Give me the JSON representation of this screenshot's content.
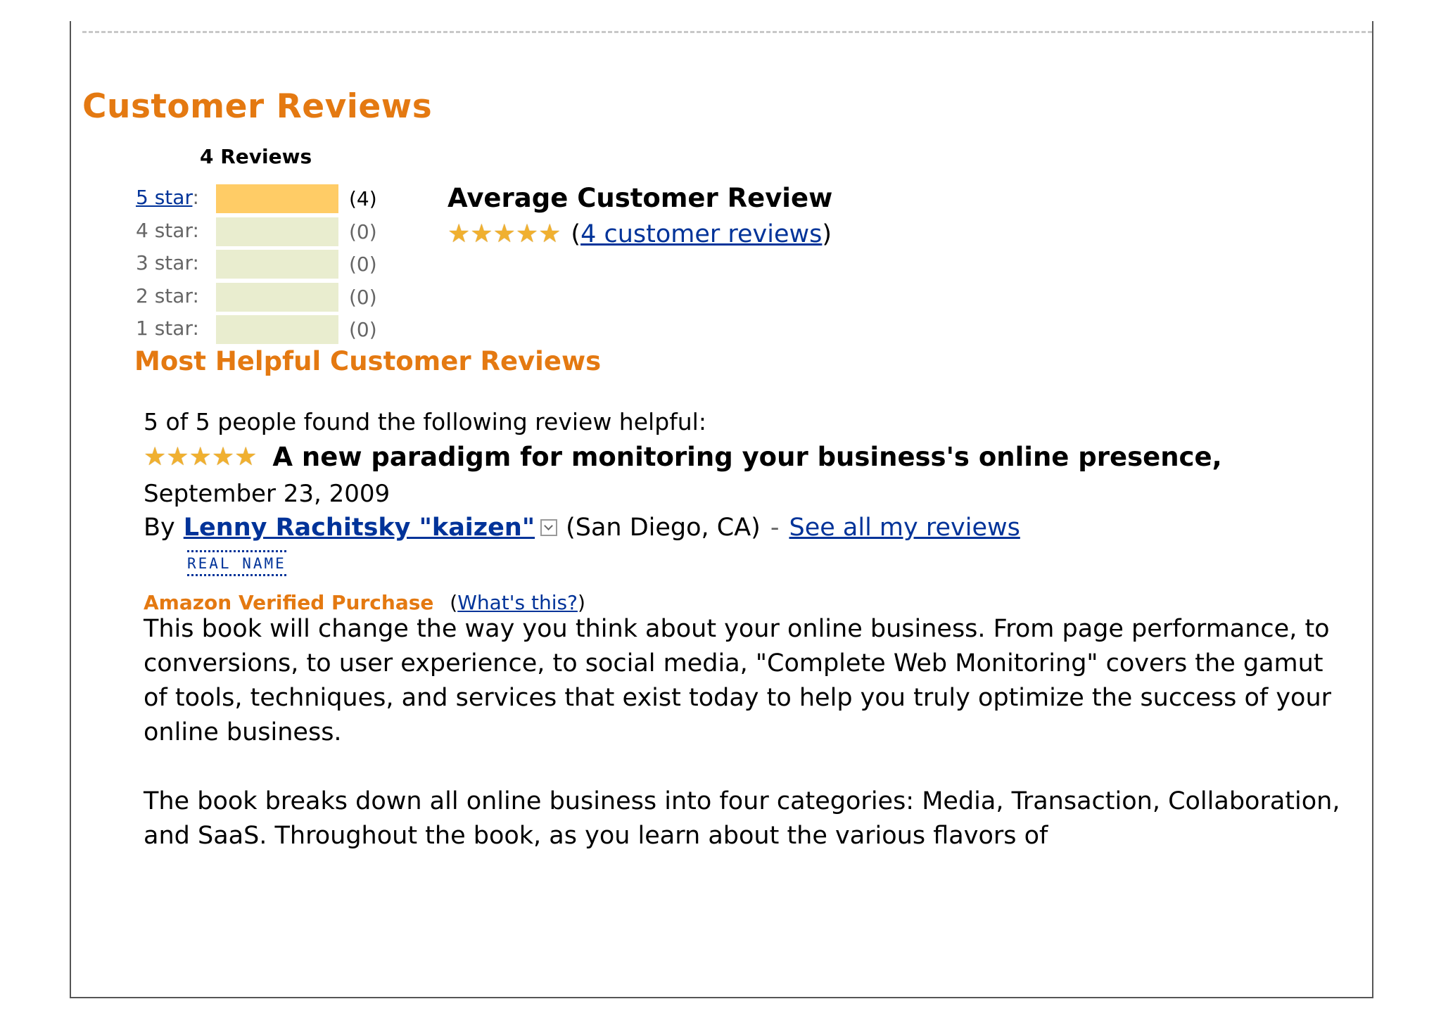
{
  "section_title": "Customer Reviews",
  "reviews_count": "4 Reviews",
  "histogram": [
    {
      "label": "5 star",
      "count": "(4)",
      "fraction": 1.0,
      "link": true
    },
    {
      "label": "4 star",
      "count": "(0)",
      "fraction": 0.0,
      "link": false
    },
    {
      "label": "3 star",
      "count": "(0)",
      "fraction": 0.0,
      "link": false
    },
    {
      "label": "2 star",
      "count": "(0)",
      "fraction": 0.0,
      "link": false
    },
    {
      "label": "1 star",
      "count": "(0)",
      "fraction": 0.0,
      "link": false
    }
  ],
  "average": {
    "title": "Average Customer Review",
    "rating_stars": 5,
    "open_paren": "(",
    "reviews_link": "4 customer reviews",
    "close_paren": ")"
  },
  "most_helpful_title": "Most Helpful Customer Reviews",
  "review": {
    "helpful_count": "5 of 5 people found the following review helpful:",
    "rating_stars": 5,
    "title": "A new paradigm for monitoring your business's online presence,",
    "date": "September 23, 2009",
    "by": "By",
    "author": "Lenny Rachitsky \"kaizen\"",
    "location": "(San Diego, CA)",
    "dash": "-",
    "see_all": "See all my reviews",
    "real_name_badge": "REAL NAME",
    "verified_label": "Amazon Verified Purchase",
    "whats_this_open": "(",
    "whats_this": "What's this?",
    "whats_this_close": ")",
    "body": [
      "This book will change the way you think about your online business. From page performance, to conversions, to user experience, to social media, \"Complete Web Monitoring\" covers the gamut of tools, techniques, and services that exist today to help you truly optimize the success of your online business.",
      "The book breaks down all online business into four categories: Media, Transaction, Collaboration, and SaaS. Throughout the book, as you learn about the various flavors of"
    ]
  },
  "colors": {
    "accent_orange": "#e47911",
    "link_blue": "#003399",
    "bar_fill": "#ffcc66",
    "bar_empty": "#e9edcf",
    "star_gold": "#f0b030"
  },
  "icons": {
    "star": "star-icon",
    "dropdown": "chevron-down-icon"
  }
}
